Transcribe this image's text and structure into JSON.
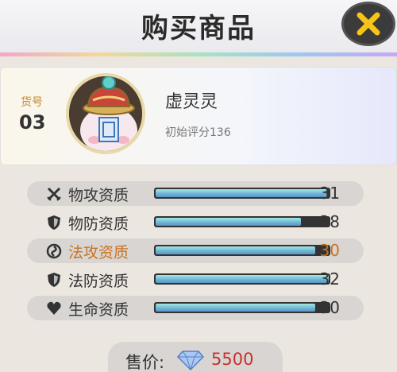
{
  "header": {
    "title": "购买商品"
  },
  "close_button": {
    "icon": "close-icon",
    "color": "#f5c518"
  },
  "item": {
    "number_label": "货号",
    "number": "03",
    "name": "虚灵灵",
    "score": "初始评分136"
  },
  "stats": [
    {
      "label": "物攻资质",
      "value": "31",
      "fill": 0.99,
      "icon": "crossed-swords-icon",
      "highlight": false
    },
    {
      "label": "物防资质",
      "value": "28",
      "fill": 0.84,
      "icon": "shield-icon",
      "highlight": false
    },
    {
      "label": "法攻资质",
      "value": "30",
      "fill": 0.92,
      "icon": "magic-swirl-icon",
      "highlight": true
    },
    {
      "label": "法防资质",
      "value": "32",
      "fill": 1.0,
      "icon": "shield-icon",
      "highlight": false
    },
    {
      "label": "生命资质",
      "value": "30",
      "fill": 0.92,
      "icon": "heart-icon",
      "highlight": false
    }
  ],
  "price": {
    "label": "售价:",
    "value": "5500",
    "icon": "diamond-icon"
  }
}
